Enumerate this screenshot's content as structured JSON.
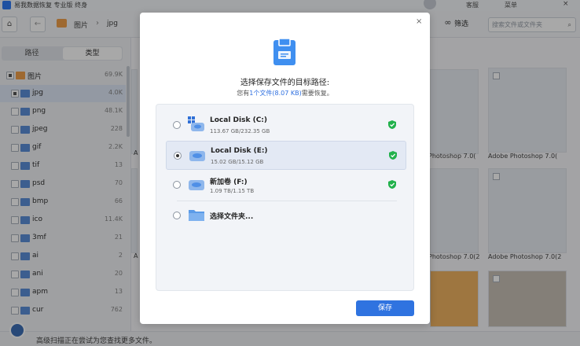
{
  "app": {
    "title": "易我数据恢复 专业版 终身",
    "btn_feedback": "客服",
    "btn_menu": "菜单",
    "close": "×"
  },
  "toolbar": {
    "home": "⌂",
    "back": "←",
    "crumbs": [
      "图片",
      "jpg"
    ],
    "crumb_sep": "›",
    "glasses": "∞",
    "filter_label": "筛选",
    "search_placeholder": "搜索文件或文件夹",
    "search_icon": "⌕"
  },
  "sidebar": {
    "tabs": [
      "路径",
      "类型"
    ],
    "root": {
      "label": "图片",
      "count": "69.9K"
    },
    "items": [
      {
        "label": "jpg",
        "count": "4.0K"
      },
      {
        "label": "png",
        "count": "48.1K"
      },
      {
        "label": "jpeg",
        "count": "228"
      },
      {
        "label": "gif",
        "count": "2.2K"
      },
      {
        "label": "tif",
        "count": "13"
      },
      {
        "label": "psd",
        "count": "70"
      },
      {
        "label": "bmp",
        "count": "66"
      },
      {
        "label": "ico",
        "count": "11.4K"
      },
      {
        "label": "3mf",
        "count": "21"
      },
      {
        "label": "ai",
        "count": "2"
      },
      {
        "label": "ani",
        "count": "20"
      },
      {
        "label": "apm",
        "count": "13"
      },
      {
        "label": "cur",
        "count": "762"
      }
    ]
  },
  "content": {
    "thumb_labels": [
      "A",
      "Photoshop 7.0(",
      "Adobe Photoshop 7.0(",
      "A",
      "Photoshop 7.0(2",
      "Adobe Photoshop 7.0(2"
    ]
  },
  "status": {
    "text": "高级扫描正在尝试为您查找更多文件。"
  },
  "dialog": {
    "title": "选择保存文件的目标路径:",
    "sub_prefix": "您有",
    "sub_highlight": "1个文件(8.07 KB)",
    "sub_suffix": "需要恢复。",
    "close": "×",
    "drives": [
      {
        "name": "Local Disk (C:)",
        "space": "113.67 GB/232.35 GB",
        "icon": "windows-disk-icon",
        "verified": true,
        "selected": false
      },
      {
        "name": "Local Disk (E:)",
        "space": "15.02 GB/15.12 GB",
        "icon": "disk-icon",
        "verified": true,
        "selected": true
      },
      {
        "name": "新加卷 (F:)",
        "space": "1.09 TB/1.15 TB",
        "icon": "disk-icon",
        "verified": true,
        "selected": false
      }
    ],
    "choose_folder": "选择文件夹...",
    "save_label": "保存"
  },
  "colors": {
    "accent": "#2f73e0",
    "shield": "#22b14c",
    "folder": "#5b8fd9"
  }
}
